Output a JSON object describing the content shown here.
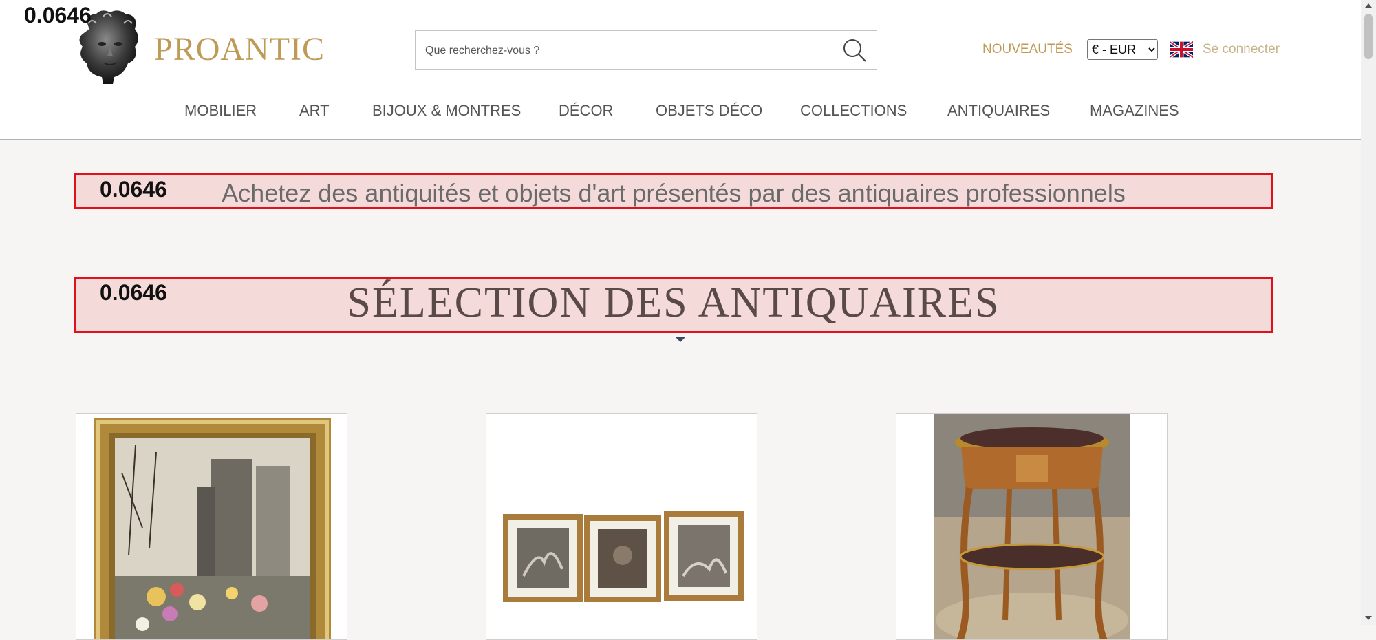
{
  "overlay_scores": {
    "top": "0.0646",
    "tagline": "0.0646",
    "title": "0.0646"
  },
  "header": {
    "brand": "PROANTIC",
    "search_placeholder": "Que recherchez-vous ?",
    "nouveautes": "NOUVEAUTÉS",
    "currency_selected": "€ - EUR",
    "login": "Se connecter"
  },
  "nav": {
    "items": [
      "MOBILIER",
      "ART",
      "BIJOUX & MONTRES",
      "DÉCOR",
      "OBJETS DÉCO",
      "COLLECTIONS",
      "ANTIQUAIRES",
      "MAGAZINES"
    ]
  },
  "main": {
    "tagline": "Achetez des antiquités et objets d'art présentés par des antiquaires professionnels",
    "section_title": "SÉLECTION DES ANTIQUAIRES"
  },
  "colors": {
    "brand_gold": "#bf9a57",
    "highlight_border": "#e0111a",
    "background": "#f6f5f3"
  },
  "icons": [
    "logo-bust-icon",
    "search-icon",
    "uk-flag-icon"
  ]
}
